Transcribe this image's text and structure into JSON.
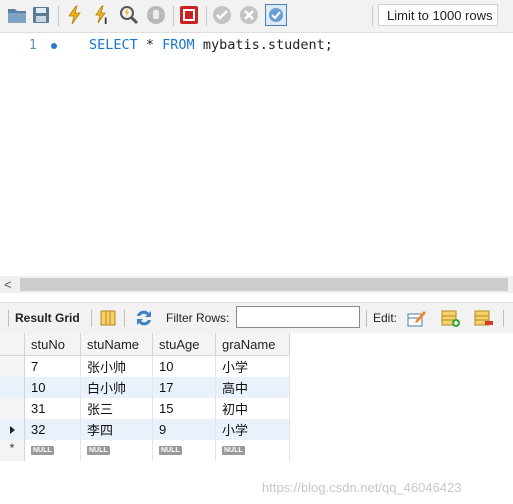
{
  "toolbar": {
    "icons": [
      "folder-open-icon",
      "save-icon",
      "execute-icon",
      "execute-current-icon",
      "explain-icon",
      "stop-icon",
      "toggle-results-icon",
      "commit-icon",
      "rollback-icon",
      "auto-commit-icon"
    ],
    "limit_label": "Limit to 1000 rows"
  },
  "editor": {
    "line_number": "1",
    "tokens": {
      "kw1": "SELECT",
      "mid": " * ",
      "kw2": "FROM",
      "rest": " mybatis.student;"
    }
  },
  "scrollbar": {
    "left_arrow": "<"
  },
  "result_toolbar": {
    "result_grid_label": "Result Grid",
    "filter_label": "Filter Rows:",
    "filter_value": "",
    "edit_label": "Edit:"
  },
  "grid": {
    "columns": [
      "stuNo",
      "stuName",
      "stuAge",
      "graName"
    ],
    "rows": [
      [
        "7",
        "张小帅",
        "10",
        "小学"
      ],
      [
        "10",
        "白小帅",
        "17",
        "高中"
      ],
      [
        "31",
        "张三",
        "15",
        "初中"
      ],
      [
        "32",
        "李四",
        "9",
        "小学"
      ]
    ],
    "null_label": "NULL",
    "new_row_marker": "*"
  },
  "watermark": "https://blog.csdn.net/qq_46046423",
  "colors": {
    "keyword": "#1976c9",
    "alt_row": "#e9f1fb",
    "toolbar_bg": "#f2f2f2"
  }
}
